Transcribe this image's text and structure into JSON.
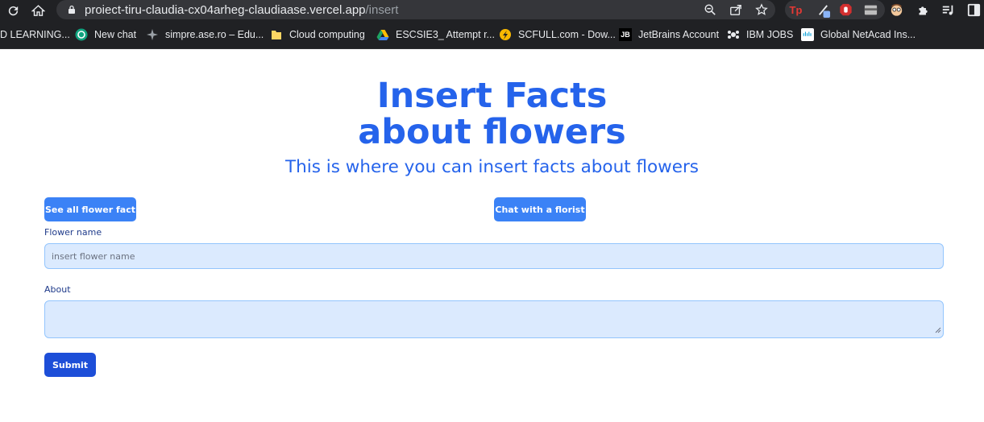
{
  "browser": {
    "url_host": "proiect-tiru-claudia-cx04arheg-claudiaase.vercel.app",
    "url_path": "/insert",
    "bookmarks": [
      {
        "label": "D LEARNING...",
        "icon": "none"
      },
      {
        "label": "New chat",
        "icon": "openai-icon"
      },
      {
        "label": "simpre.ase.ro – Edu...",
        "icon": "moodle-icon"
      },
      {
        "label": "Cloud computing",
        "icon": "folder-icon"
      },
      {
        "label": "ESCSIE3_ Attempt r...",
        "icon": "drive-icon"
      },
      {
        "label": "SCFULL.com - Dow...",
        "icon": "scfull-icon"
      },
      {
        "label": "JetBrains Account",
        "icon": "jetbrains-icon"
      },
      {
        "label": "IBM JOBS",
        "icon": "ibm-icon"
      },
      {
        "label": "Global NetAcad Ins...",
        "icon": "cisco-icon"
      }
    ],
    "extensions": {
      "tp_label": "Tp",
      "jb_label": "JB"
    }
  },
  "page": {
    "title_line1": "Insert Facts",
    "title_line2": "about flowers",
    "subtitle": "This is where you can insert facts about flowers",
    "see_all_button": "See all flower fact",
    "chat_button": "Chat with a florist",
    "flower_name_label": "Flower name",
    "flower_name_placeholder": "insert flower name",
    "about_label": "About",
    "submit_button": "Submit"
  },
  "colors": {
    "accent": "#2563eb",
    "button": "#3b82f6",
    "submit": "#1d4ed8",
    "field_bg": "#dbeafe"
  }
}
